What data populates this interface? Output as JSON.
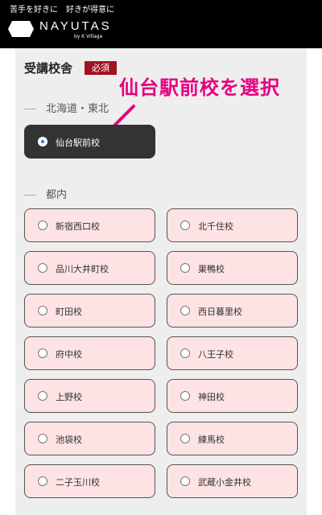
{
  "header": {
    "tagline": "苦手を好きに　好きが得意に",
    "logo_text": "NAYUTAS",
    "logo_sub": "by K Village"
  },
  "form": {
    "section_label": "受講校舎",
    "required_badge": "必須"
  },
  "annotation": {
    "text": "仙台駅前校を選択",
    "color": "#e6007e"
  },
  "regions": [
    {
      "name": "北海道・東北",
      "schools": [
        {
          "label": "仙台駅前校",
          "selected": true
        }
      ]
    },
    {
      "name": "都内",
      "schools": [
        {
          "label": "新宿西口校",
          "selected": false
        },
        {
          "label": "北千住校",
          "selected": false
        },
        {
          "label": "品川大井町校",
          "selected": false
        },
        {
          "label": "巣鴨校",
          "selected": false
        },
        {
          "label": "町田校",
          "selected": false
        },
        {
          "label": "西日暮里校",
          "selected": false
        },
        {
          "label": "府中校",
          "selected": false
        },
        {
          "label": "八王子校",
          "selected": false
        },
        {
          "label": "上野校",
          "selected": false
        },
        {
          "label": "神田校",
          "selected": false
        },
        {
          "label": "池袋校",
          "selected": false
        },
        {
          "label": "練馬校",
          "selected": false
        },
        {
          "label": "二子玉川校",
          "selected": false
        },
        {
          "label": "武蔵小金井校",
          "selected": false
        }
      ]
    }
  ],
  "colors": {
    "header_bg": "#000000",
    "badge_bg": "#a01320",
    "option_bg": "#fde3e3",
    "selected_bg": "#333333",
    "radio_selected": "#2f6fd6"
  }
}
